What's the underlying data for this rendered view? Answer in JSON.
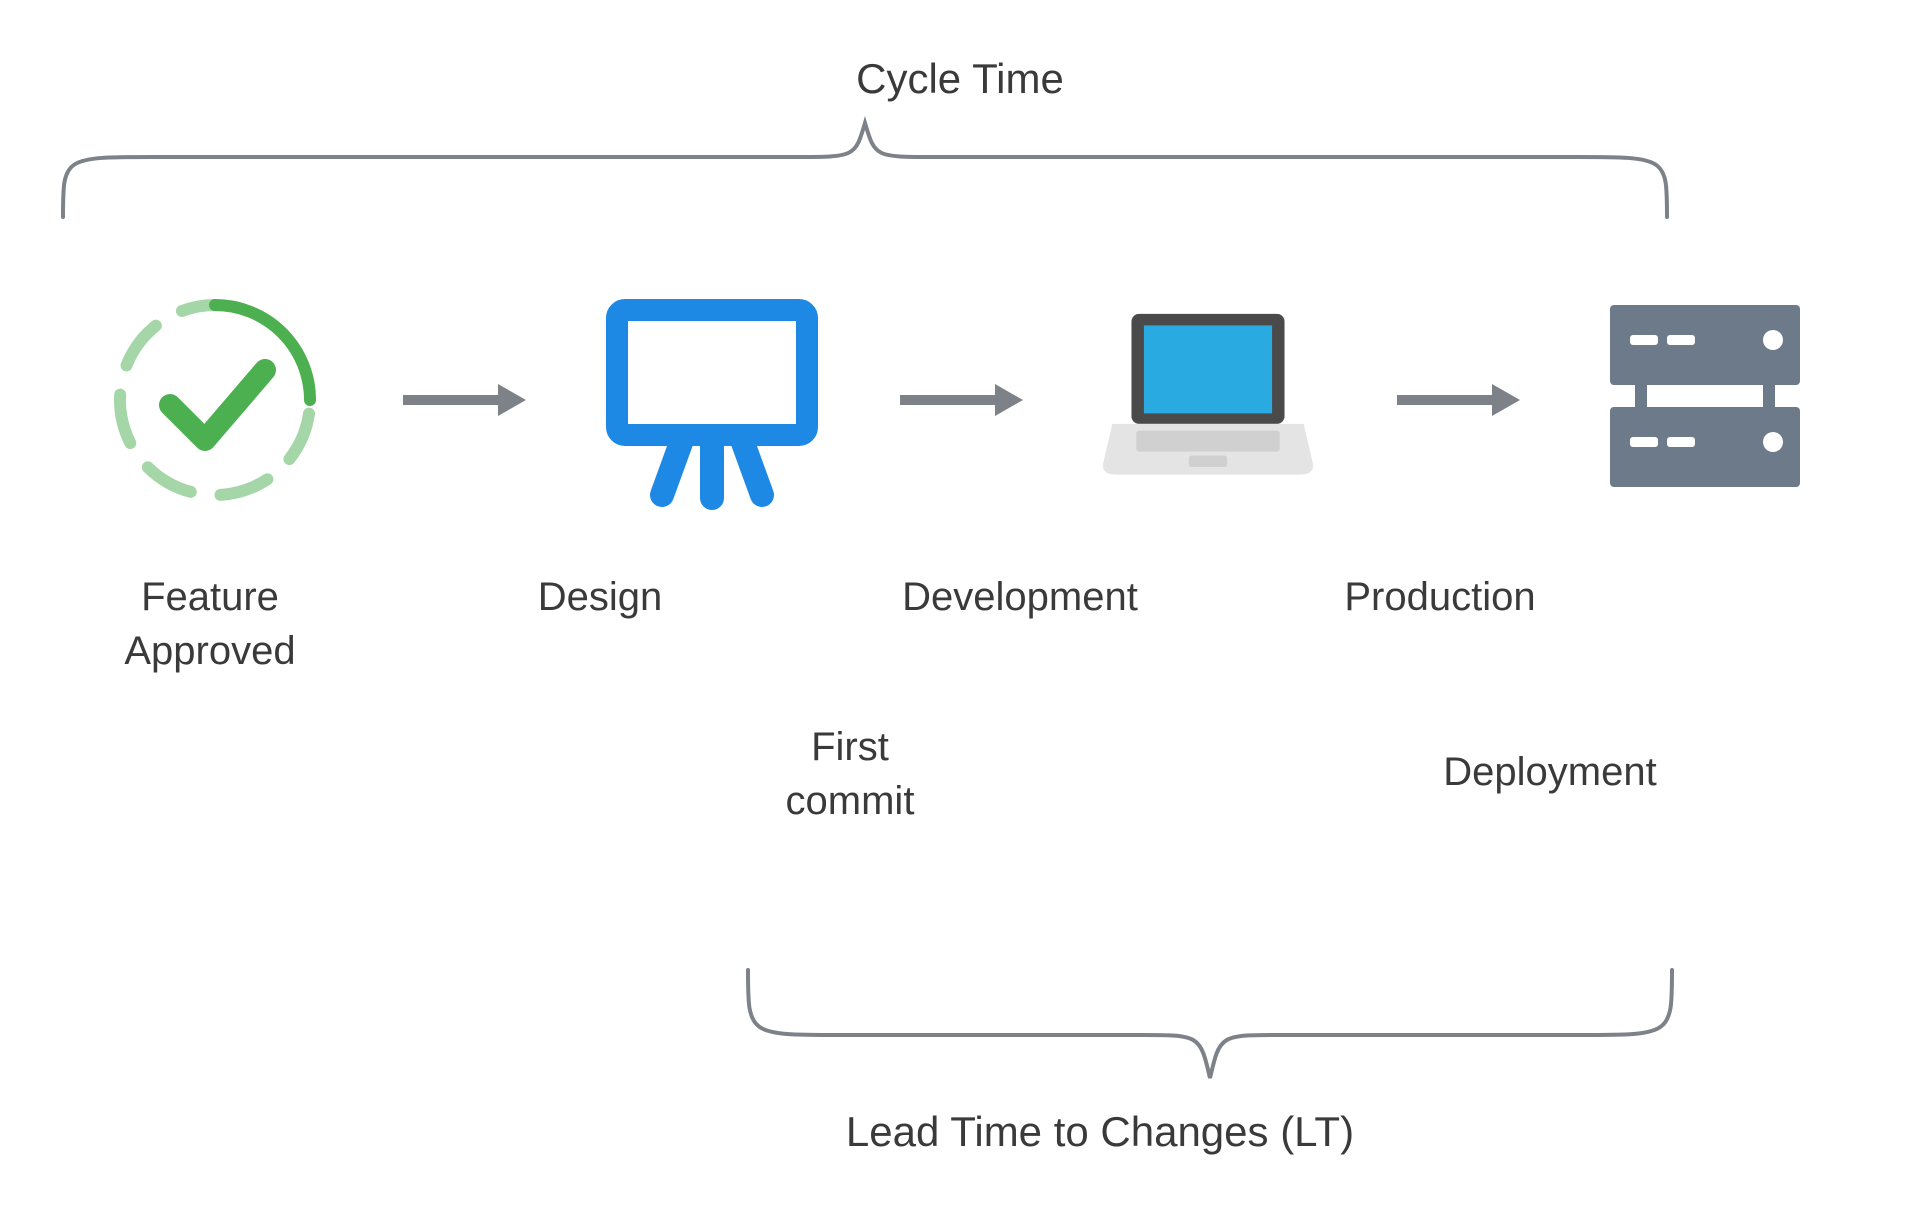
{
  "title_top": "Cycle Time",
  "title_bottom": "Lead Time to Changes (LT)",
  "stages": {
    "feature_approved": "Feature\nApproved",
    "design": "Design",
    "development": "Development",
    "production": "Production"
  },
  "sublabels": {
    "first_commit": "First\ncommit",
    "deployment": "Deployment"
  },
  "colors": {
    "text": "#3a3a3a",
    "brace": "#7c8288",
    "arrow": "#7c8288",
    "green": "#4caf50",
    "green_light": "#a5d6a7",
    "blue": "#1e88e5",
    "screen_blue": "#29abe2",
    "server_gray": "#6c7a89",
    "laptop_dark": "#4a4a4a",
    "laptop_light": "#d0d0d0"
  }
}
